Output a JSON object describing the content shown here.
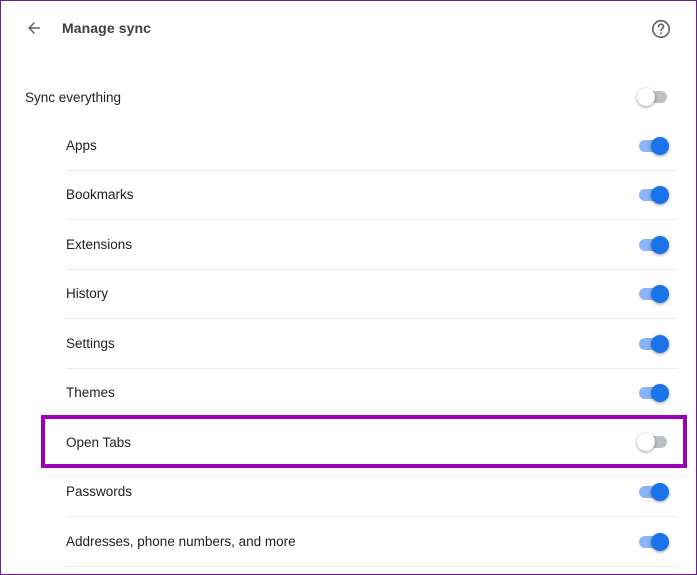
{
  "header": {
    "title": "Manage sync",
    "back_icon": "arrow-back-icon",
    "help_icon": "help-circle-icon"
  },
  "sync_everything": {
    "label": "Sync everything",
    "enabled": false
  },
  "items": [
    {
      "label": "Apps",
      "enabled": true
    },
    {
      "label": "Bookmarks",
      "enabled": true
    },
    {
      "label": "Extensions",
      "enabled": true
    },
    {
      "label": "History",
      "enabled": true
    },
    {
      "label": "Settings",
      "enabled": true
    },
    {
      "label": "Themes",
      "enabled": true
    },
    {
      "label": "Open Tabs",
      "enabled": false
    },
    {
      "label": "Passwords",
      "enabled": true
    },
    {
      "label": "Addresses, phone numbers, and more",
      "enabled": true
    }
  ],
  "colors": {
    "accent": "#1a73e8",
    "highlight": "#9a00b5"
  }
}
